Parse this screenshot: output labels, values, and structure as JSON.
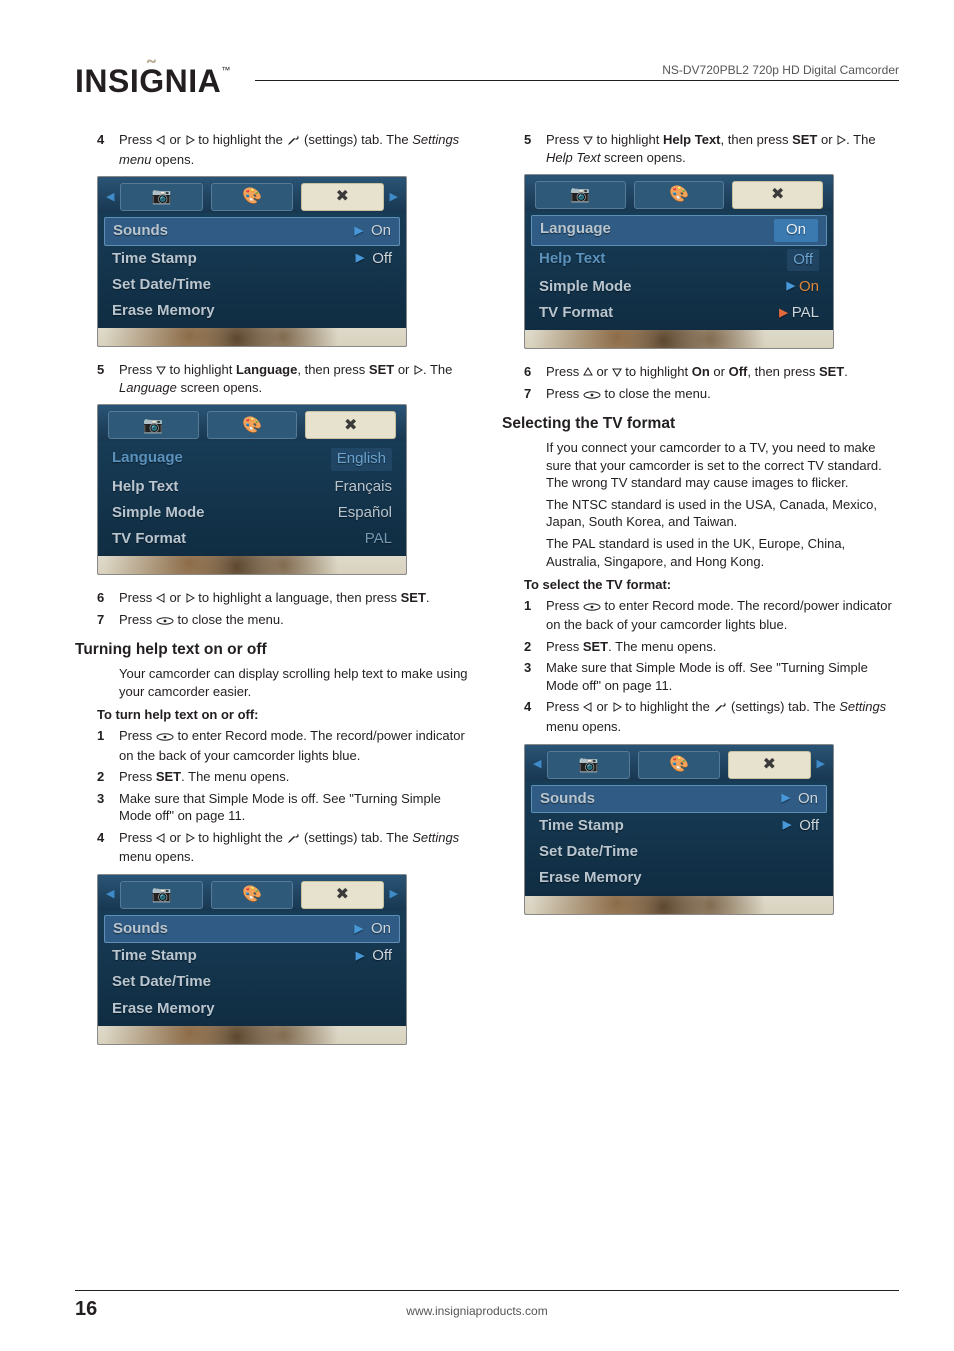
{
  "header": {
    "brand": "INSIGNIA",
    "tm": "™",
    "product": "NS-DV720PBL2 720p HD Digital Camcorder"
  },
  "leftCol": {
    "step4": {
      "num": "4",
      "a": "Press ",
      "b": " or ",
      "c": " to highlight the ",
      "d": " (settings) tab. The ",
      "e": "Settings menu",
      "f": " opens."
    },
    "ss1": {
      "rows": [
        {
          "label": "Sounds",
          "val": "On"
        },
        {
          "label": "Time Stamp",
          "val": "Off"
        },
        {
          "label": "Set Date/Time",
          "val": ""
        },
        {
          "label": "Erase Memory",
          "val": ""
        }
      ]
    },
    "step5": {
      "num": "5",
      "a": "Press ",
      "b": " to highlight ",
      "lang": "Language",
      "c": ", then press ",
      "set": "SET",
      "d": " or ",
      "e": ". The ",
      "f": "Language",
      "g": " screen opens."
    },
    "ss2": {
      "rows": [
        {
          "label": "Language",
          "val": "English"
        },
        {
          "label": "Help Text",
          "val": "Français"
        },
        {
          "label": "Simple Mode",
          "val": "Español"
        },
        {
          "label": "TV Format",
          "val": "PAL"
        }
      ]
    },
    "step6": {
      "num": "6",
      "a": "Press ",
      "b": " or ",
      "c": " to highlight a language, then press ",
      "set": "SET",
      "d": "."
    },
    "step7": {
      "num": "7",
      "a": "Press ",
      "b": " to close the menu."
    },
    "h_help": "Turning help text on or off",
    "help_para": "Your camcorder can display scrolling help text to make using your camcorder easier.",
    "help_sub": "To turn help text on or off:",
    "hstep1": {
      "num": "1",
      "a": "Press ",
      "b": " to enter Record mode. The record/power indicator on the back of your camcorder lights blue."
    },
    "hstep2": {
      "num": "2",
      "a": "Press ",
      "set": "SET",
      "b": ". The menu opens."
    },
    "hstep3": {
      "num": "3",
      "a": "Make sure that Simple Mode is off. See \"Turning Simple Mode off\" on page 11."
    },
    "hstep4": {
      "num": "4",
      "a": "Press ",
      "b": " or ",
      "c": " to highlight the ",
      "d": " (settings) tab. The ",
      "e": "Settings",
      "f": " menu opens."
    }
  },
  "rightCol": {
    "rstep5": {
      "num": "5",
      "a": "Press ",
      "b": " to highlight ",
      "ht": "Help Text",
      "c": ", then press ",
      "set": "SET",
      "d": " or ",
      "e": ". The ",
      "f": "Help Text",
      "g": " screen opens."
    },
    "ss4": {
      "rows": [
        {
          "label": "Language",
          "val": "On"
        },
        {
          "label": "Help Text",
          "val": "Off"
        },
        {
          "label": "Simple Mode",
          "val": "On"
        },
        {
          "label": "TV Format",
          "val": "PAL"
        }
      ]
    },
    "rstep6": {
      "num": "6",
      "a": "Press ",
      "b": " or ",
      "c": " to highlight ",
      "on": "On",
      "or": " or ",
      "off": "Off",
      "d": ", then press ",
      "set": "SET",
      "e": "."
    },
    "rstep7": {
      "num": "7",
      "a": "Press ",
      "b": " to close the menu."
    },
    "h_tv": "Selecting the TV format",
    "tv_p1": "If you connect your camcorder to a TV, you need to make sure that your camcorder is set to the correct TV standard. The wrong TV standard may cause images to flicker.",
    "tv_p2": "The NTSC standard is used in the USA, Canada, Mexico, Japan, South Korea, and Taiwan.",
    "tv_p3": "The PAL standard is used in the UK, Europe, China, Australia, Singapore, and Hong Kong.",
    "tv_sub": "To select the TV format:",
    "tstep1": {
      "num": "1",
      "a": "Press ",
      "b": " to enter Record mode. The record/power indicator on the back of your camcorder lights blue."
    },
    "tstep2": {
      "num": "2",
      "a": "Press ",
      "set": "SET",
      "b": ". The menu opens."
    },
    "tstep3": {
      "num": "3",
      "a": "Make sure that Simple Mode is off. See \"Turning Simple Mode off\" on page 11."
    },
    "tstep4": {
      "num": "4",
      "a": "Press ",
      "b": " or ",
      "c": " to highlight the ",
      "d": " (settings) tab. The ",
      "e": "Settings",
      "f": " menu opens."
    }
  },
  "footer": {
    "pageNum": "16",
    "url": "www.insigniaproducts.com"
  }
}
